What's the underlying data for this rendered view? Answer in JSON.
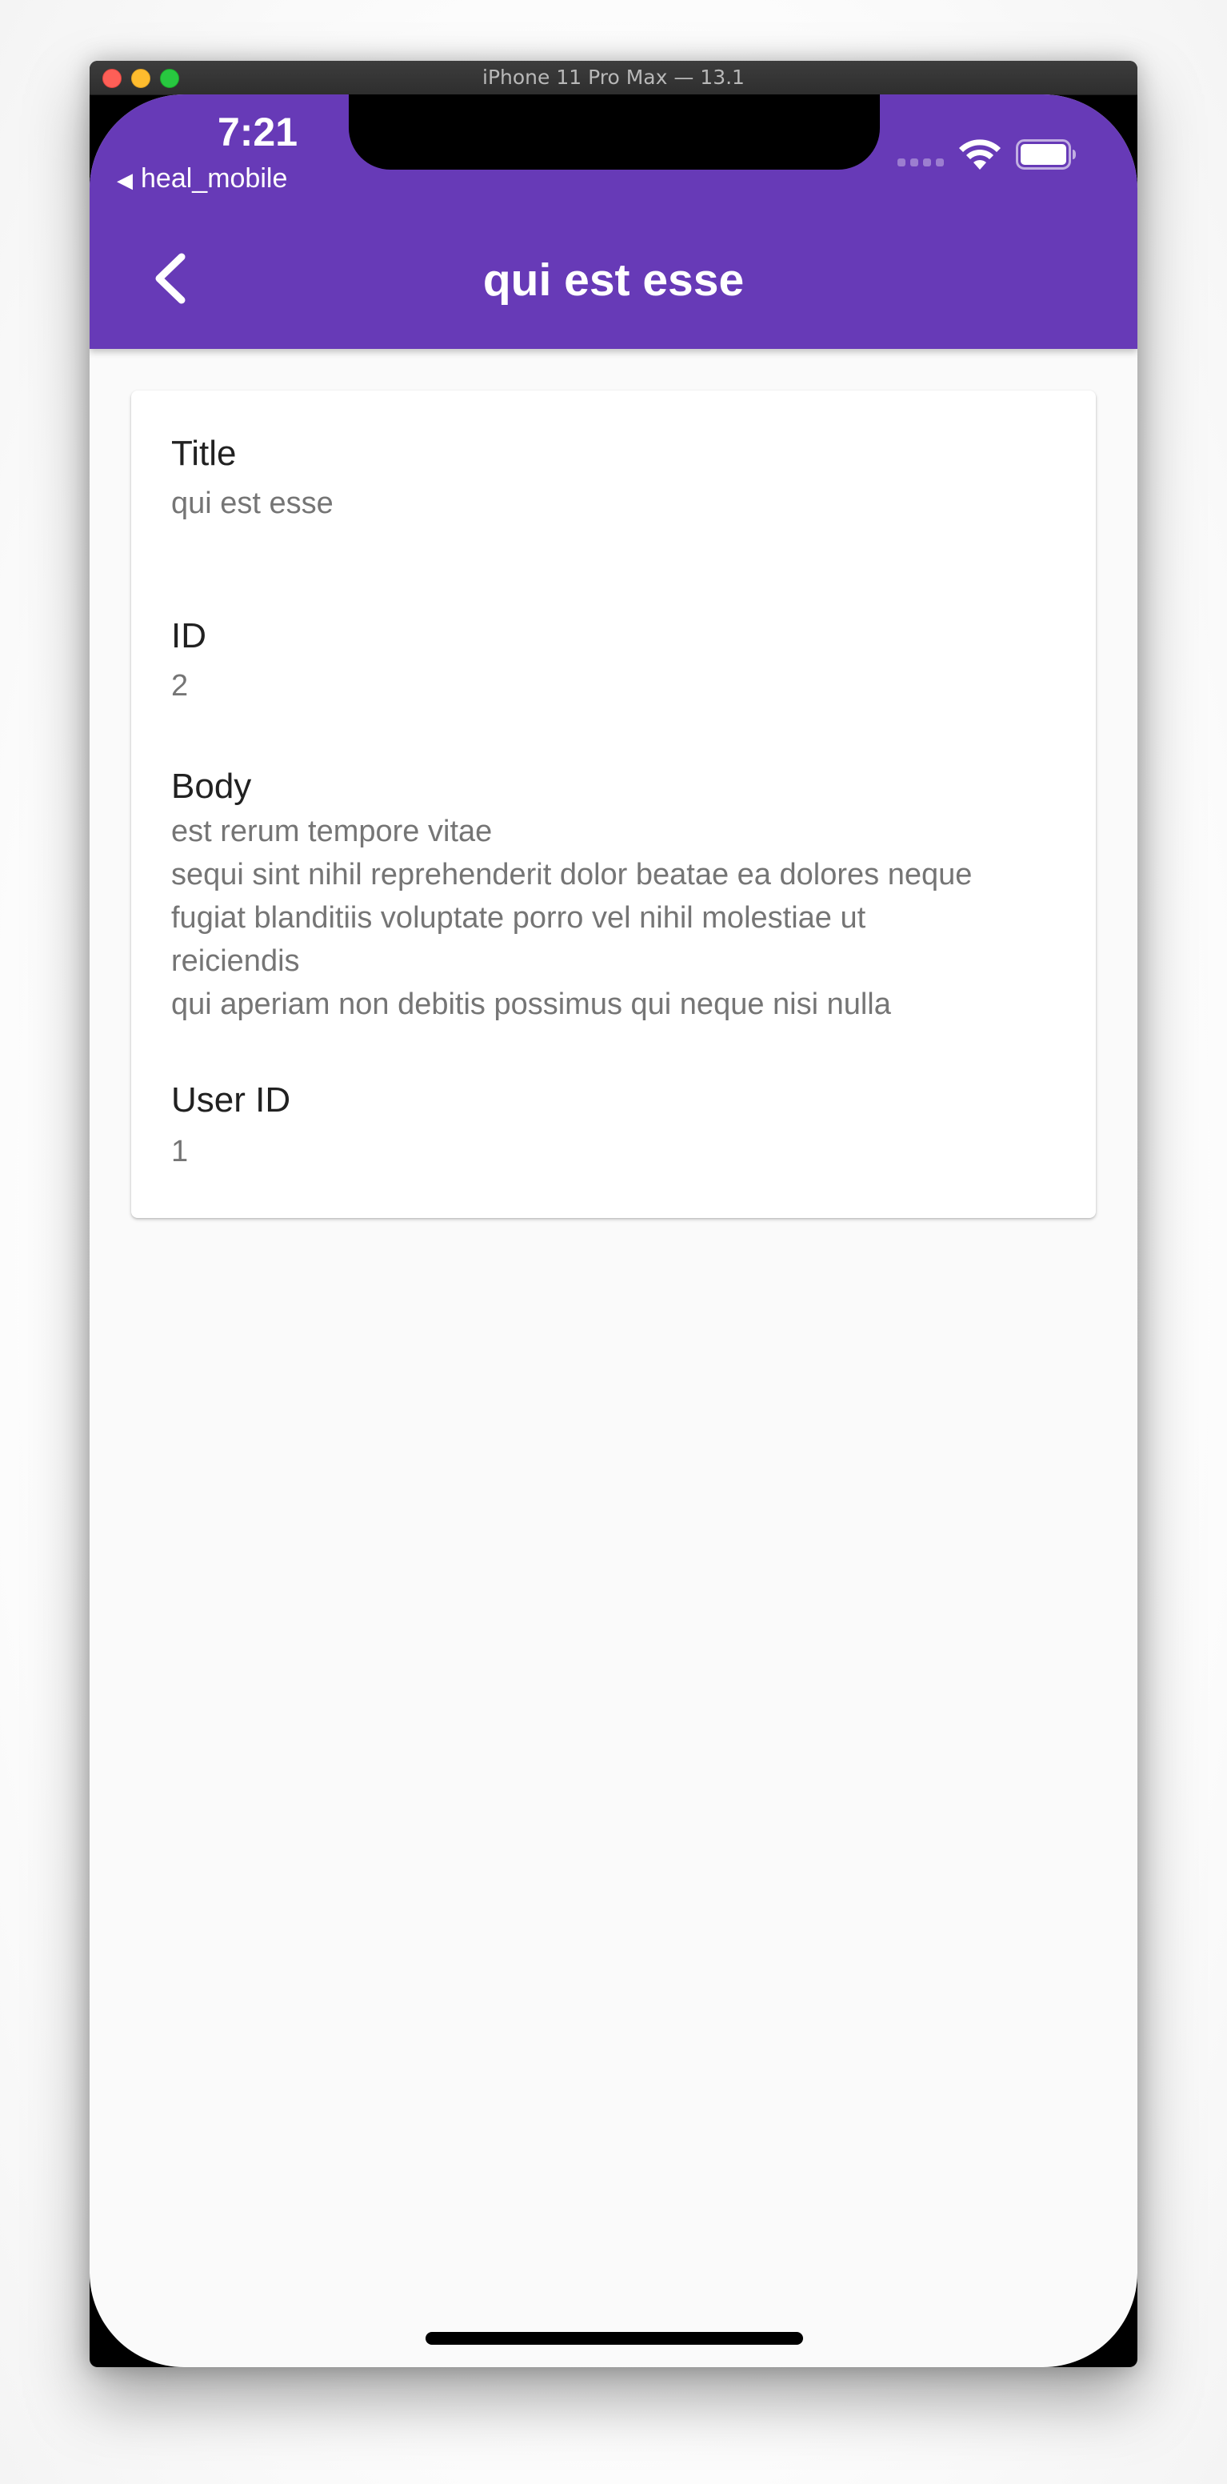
{
  "simulator": {
    "window_title": "iPhone 11 Pro Max — 13.1"
  },
  "status_bar": {
    "time": "7:21",
    "back_app": "heal_mobile",
    "back_glyph": "◀"
  },
  "app_bar": {
    "title": "qui est esse",
    "back_icon": "chevron-left-icon",
    "color": "#673ab7"
  },
  "post": {
    "title_label": "Title",
    "title_value": "qui est esse",
    "id_label": "ID",
    "id_value": "2",
    "body_label": "Body",
    "body_value": "est rerum tempore vitae\nsequi sint nihil reprehenderit dolor beatae ea dolores neque\nfugiat blanditiis voluptate porro vel nihil molestiae ut\nreiciendis\nqui aperiam non debitis possimus qui neque nisi nulla",
    "user_id_label": "User ID",
    "user_id_value": "1"
  }
}
